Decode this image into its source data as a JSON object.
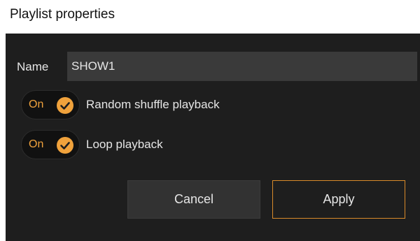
{
  "window": {
    "title": "Playlist properties"
  },
  "form": {
    "name_label": "Name",
    "name_value": "SHOW1"
  },
  "options": [
    {
      "toggle_text": "On",
      "checked": true,
      "label": "Random shuffle playback"
    },
    {
      "toggle_text": "On",
      "checked": true,
      "label": "Loop playback"
    }
  ],
  "buttons": {
    "cancel_label": "Cancel",
    "apply_label": "Apply"
  },
  "colors": {
    "background": "#1e1e1e",
    "input_background": "#3a3a3a",
    "accent": "#f0a23c",
    "apply_border": "#d98a2a",
    "text": "#e6e6e6"
  }
}
